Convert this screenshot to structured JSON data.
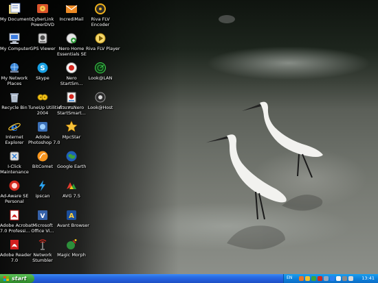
{
  "desktop": {
    "icons": [
      {
        "label": "My Documents",
        "icon": "my-documents-icon"
      },
      {
        "label": "CyberLink\nPowerDVD",
        "icon": "powerdvd-icon"
      },
      {
        "label": "IncrediMail",
        "icon": "incredimail-icon"
      },
      {
        "label": "Riva FLV\nEncoder",
        "icon": "riva-encoder-icon"
      },
      {
        "label": "My Computer",
        "icon": "my-computer-icon"
      },
      {
        "label": "GPS Viewer",
        "icon": "gps-viewer-icon"
      },
      {
        "label": "Nero Home\nEssentials SE",
        "icon": "nero-home-icon"
      },
      {
        "label": "Riva FLV Player",
        "icon": "riva-player-icon"
      },
      {
        "label": "My Network\nPlaces",
        "icon": "network-places-icon"
      },
      {
        "label": "Skype",
        "icon": "skype-icon"
      },
      {
        "label": "Nero\nStartSm...",
        "icon": "nero-startsmart-icon"
      },
      {
        "label": "Look@LAN",
        "icon": "lookatlan-icon"
      },
      {
        "label": "Recycle Bin",
        "icon": "recycle-bin-icon"
      },
      {
        "label": "TuneUp Utilities\n2004",
        "icon": "tuneup-icon"
      },
      {
        "label": "ตัวแทนNero\nStartSmart...",
        "icon": "nero-thai-icon"
      },
      {
        "label": "Look@Host",
        "icon": "lookathost-icon"
      },
      {
        "label": "Internet\nExplorer",
        "icon": "internet-explorer-icon"
      },
      {
        "label": "Adobe\nPhotoshop 7.0",
        "icon": "photoshop-icon"
      },
      {
        "label": "MpcStar",
        "icon": "mpcstar-icon"
      },
      {
        "label": "",
        "icon": ""
      },
      {
        "label": "I-Click\nMaintenance",
        "icon": "iclick-icon"
      },
      {
        "label": "BitComet",
        "icon": "bitcomet-icon"
      },
      {
        "label": "Google Earth",
        "icon": "google-earth-icon"
      },
      {
        "label": "",
        "icon": ""
      },
      {
        "label": "Ad-Aware SE\nPersonal",
        "icon": "adaware-icon"
      },
      {
        "label": "ipscan",
        "icon": "ipscan-icon"
      },
      {
        "label": "AVG 7.5",
        "icon": "avg-icon"
      },
      {
        "label": "",
        "icon": ""
      },
      {
        "label": "Adobe Acrobat\n7.0 Professi...",
        "icon": "acrobat-icon"
      },
      {
        "label": "Microsoft\nOffice Vi...",
        "icon": "office-visio-icon"
      },
      {
        "label": "Avant Browser",
        "icon": "avant-browser-icon"
      },
      {
        "label": "",
        "icon": ""
      },
      {
        "label": "Adobe Reader\n7.0",
        "icon": "adobe-reader-icon"
      },
      {
        "label": "Network\nStumbler",
        "icon": "network-stumbler-icon"
      },
      {
        "label": "Magic Morph",
        "icon": "magic-morph-icon"
      }
    ]
  },
  "taskbar": {
    "start_label": "start",
    "language": "EN",
    "clock": "13:41"
  },
  "colors": {
    "taskbar_blue": "#245edb",
    "start_green": "#3fa33a",
    "tray_blue": "#0e82dc"
  }
}
